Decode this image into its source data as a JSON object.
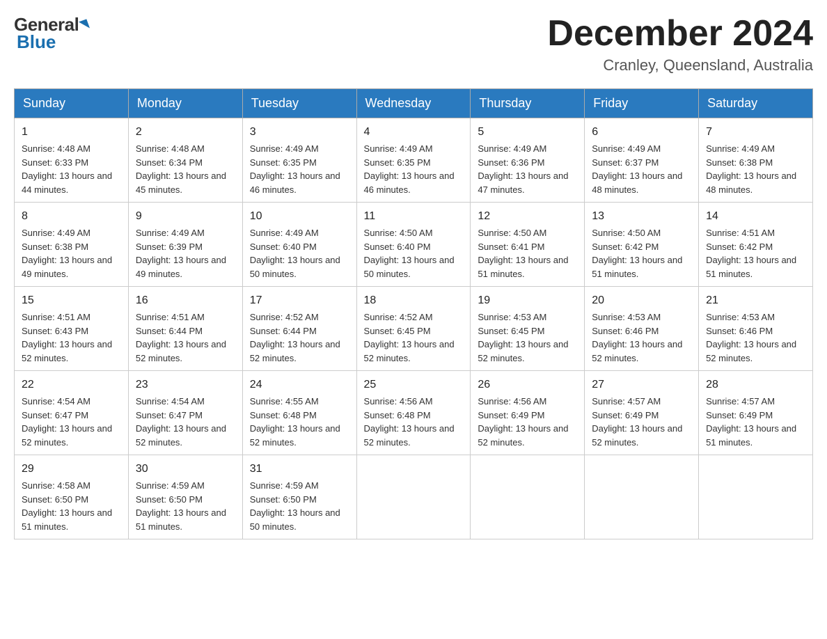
{
  "logo": {
    "general_text": "General",
    "blue_text": "Blue"
  },
  "title": "December 2024",
  "subtitle": "Cranley, Queensland, Australia",
  "weekdays": [
    "Sunday",
    "Monday",
    "Tuesday",
    "Wednesday",
    "Thursday",
    "Friday",
    "Saturday"
  ],
  "weeks": [
    [
      {
        "day": 1,
        "sunrise": "4:48 AM",
        "sunset": "6:33 PM",
        "daylight": "13 hours and 44 minutes."
      },
      {
        "day": 2,
        "sunrise": "4:48 AM",
        "sunset": "6:34 PM",
        "daylight": "13 hours and 45 minutes."
      },
      {
        "day": 3,
        "sunrise": "4:49 AM",
        "sunset": "6:35 PM",
        "daylight": "13 hours and 46 minutes."
      },
      {
        "day": 4,
        "sunrise": "4:49 AM",
        "sunset": "6:35 PM",
        "daylight": "13 hours and 46 minutes."
      },
      {
        "day": 5,
        "sunrise": "4:49 AM",
        "sunset": "6:36 PM",
        "daylight": "13 hours and 47 minutes."
      },
      {
        "day": 6,
        "sunrise": "4:49 AM",
        "sunset": "6:37 PM",
        "daylight": "13 hours and 48 minutes."
      },
      {
        "day": 7,
        "sunrise": "4:49 AM",
        "sunset": "6:38 PM",
        "daylight": "13 hours and 48 minutes."
      }
    ],
    [
      {
        "day": 8,
        "sunrise": "4:49 AM",
        "sunset": "6:38 PM",
        "daylight": "13 hours and 49 minutes."
      },
      {
        "day": 9,
        "sunrise": "4:49 AM",
        "sunset": "6:39 PM",
        "daylight": "13 hours and 49 minutes."
      },
      {
        "day": 10,
        "sunrise": "4:49 AM",
        "sunset": "6:40 PM",
        "daylight": "13 hours and 50 minutes."
      },
      {
        "day": 11,
        "sunrise": "4:50 AM",
        "sunset": "6:40 PM",
        "daylight": "13 hours and 50 minutes."
      },
      {
        "day": 12,
        "sunrise": "4:50 AM",
        "sunset": "6:41 PM",
        "daylight": "13 hours and 51 minutes."
      },
      {
        "day": 13,
        "sunrise": "4:50 AM",
        "sunset": "6:42 PM",
        "daylight": "13 hours and 51 minutes."
      },
      {
        "day": 14,
        "sunrise": "4:51 AM",
        "sunset": "6:42 PM",
        "daylight": "13 hours and 51 minutes."
      }
    ],
    [
      {
        "day": 15,
        "sunrise": "4:51 AM",
        "sunset": "6:43 PM",
        "daylight": "13 hours and 52 minutes."
      },
      {
        "day": 16,
        "sunrise": "4:51 AM",
        "sunset": "6:44 PM",
        "daylight": "13 hours and 52 minutes."
      },
      {
        "day": 17,
        "sunrise": "4:52 AM",
        "sunset": "6:44 PM",
        "daylight": "13 hours and 52 minutes."
      },
      {
        "day": 18,
        "sunrise": "4:52 AM",
        "sunset": "6:45 PM",
        "daylight": "13 hours and 52 minutes."
      },
      {
        "day": 19,
        "sunrise": "4:53 AM",
        "sunset": "6:45 PM",
        "daylight": "13 hours and 52 minutes."
      },
      {
        "day": 20,
        "sunrise": "4:53 AM",
        "sunset": "6:46 PM",
        "daylight": "13 hours and 52 minutes."
      },
      {
        "day": 21,
        "sunrise": "4:53 AM",
        "sunset": "6:46 PM",
        "daylight": "13 hours and 52 minutes."
      }
    ],
    [
      {
        "day": 22,
        "sunrise": "4:54 AM",
        "sunset": "6:47 PM",
        "daylight": "13 hours and 52 minutes."
      },
      {
        "day": 23,
        "sunrise": "4:54 AM",
        "sunset": "6:47 PM",
        "daylight": "13 hours and 52 minutes."
      },
      {
        "day": 24,
        "sunrise": "4:55 AM",
        "sunset": "6:48 PM",
        "daylight": "13 hours and 52 minutes."
      },
      {
        "day": 25,
        "sunrise": "4:56 AM",
        "sunset": "6:48 PM",
        "daylight": "13 hours and 52 minutes."
      },
      {
        "day": 26,
        "sunrise": "4:56 AM",
        "sunset": "6:49 PM",
        "daylight": "13 hours and 52 minutes."
      },
      {
        "day": 27,
        "sunrise": "4:57 AM",
        "sunset": "6:49 PM",
        "daylight": "13 hours and 52 minutes."
      },
      {
        "day": 28,
        "sunrise": "4:57 AM",
        "sunset": "6:49 PM",
        "daylight": "13 hours and 51 minutes."
      }
    ],
    [
      {
        "day": 29,
        "sunrise": "4:58 AM",
        "sunset": "6:50 PM",
        "daylight": "13 hours and 51 minutes."
      },
      {
        "day": 30,
        "sunrise": "4:59 AM",
        "sunset": "6:50 PM",
        "daylight": "13 hours and 51 minutes."
      },
      {
        "day": 31,
        "sunrise": "4:59 AM",
        "sunset": "6:50 PM",
        "daylight": "13 hours and 50 minutes."
      },
      null,
      null,
      null,
      null
    ]
  ]
}
